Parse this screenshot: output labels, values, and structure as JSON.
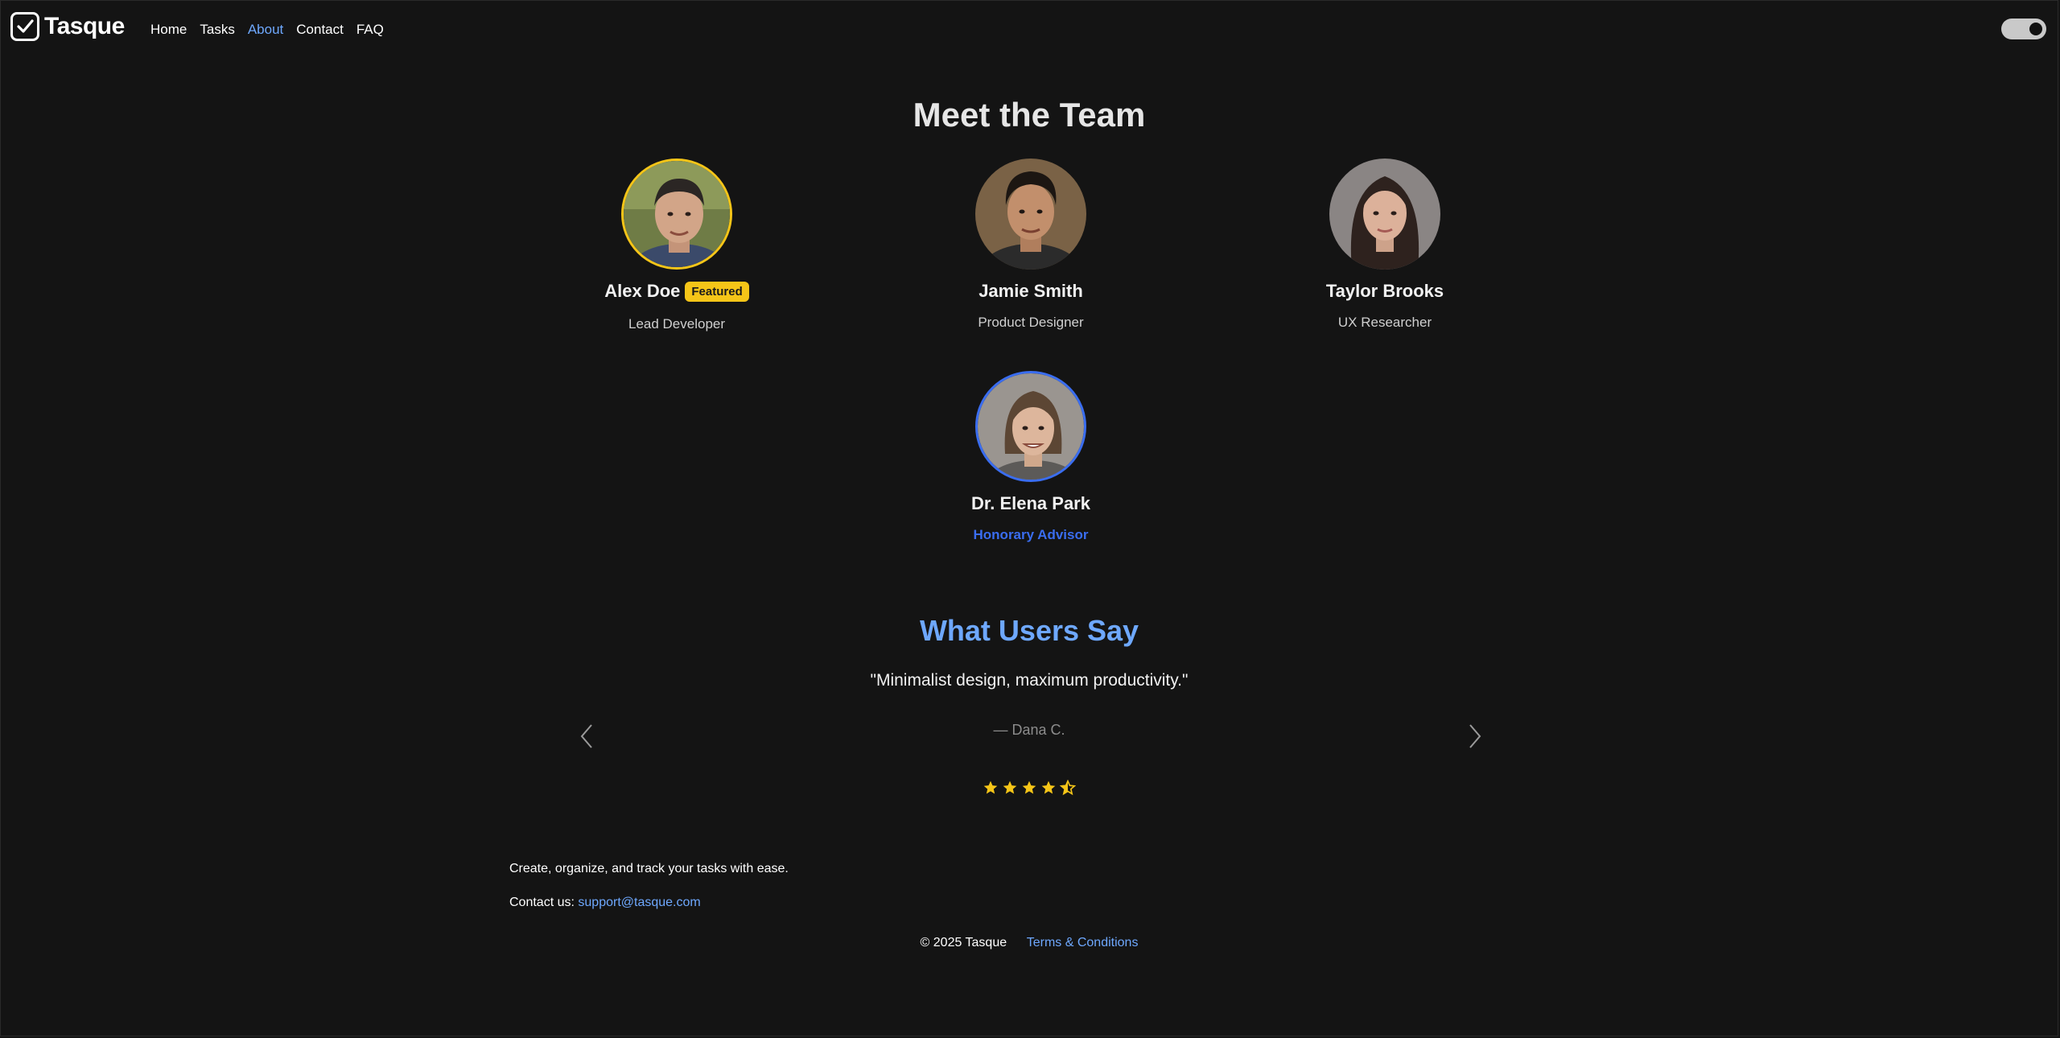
{
  "app": {
    "logo_text": "Tasque"
  },
  "nav": {
    "items": [
      {
        "label": "Home"
      },
      {
        "label": "Tasks"
      },
      {
        "label": "About"
      },
      {
        "label": "Contact"
      },
      {
        "label": "FAQ"
      }
    ],
    "active": "About"
  },
  "team": {
    "title": "Meet the Team",
    "members": [
      {
        "name": "Alex Doe",
        "role": "Lead Developer",
        "badge": "Featured"
      },
      {
        "name": "Jamie Smith",
        "role": "Product Designer"
      },
      {
        "name": "Taylor Brooks",
        "role": "UX Researcher"
      },
      {
        "name": "Dr. Elena Park",
        "role": "Honorary Advisor"
      }
    ]
  },
  "testimonials": {
    "title": "What Users Say",
    "quote": "\"Minimalist design, maximum productivity.\"",
    "author": "— Dana C.",
    "rating": 4.5
  },
  "footer": {
    "tagline": "Create, organize, and track your tasks with ease.",
    "contact_label": "Contact us:",
    "contact_email": "support@tasque.com",
    "copyright": "© 2025 Tasque",
    "terms_label": "Terms & Conditions"
  },
  "colors": {
    "background": "#141414",
    "accent": "#6ea8fe",
    "featured": "#f5c518",
    "honorary": "#3a6df0"
  }
}
